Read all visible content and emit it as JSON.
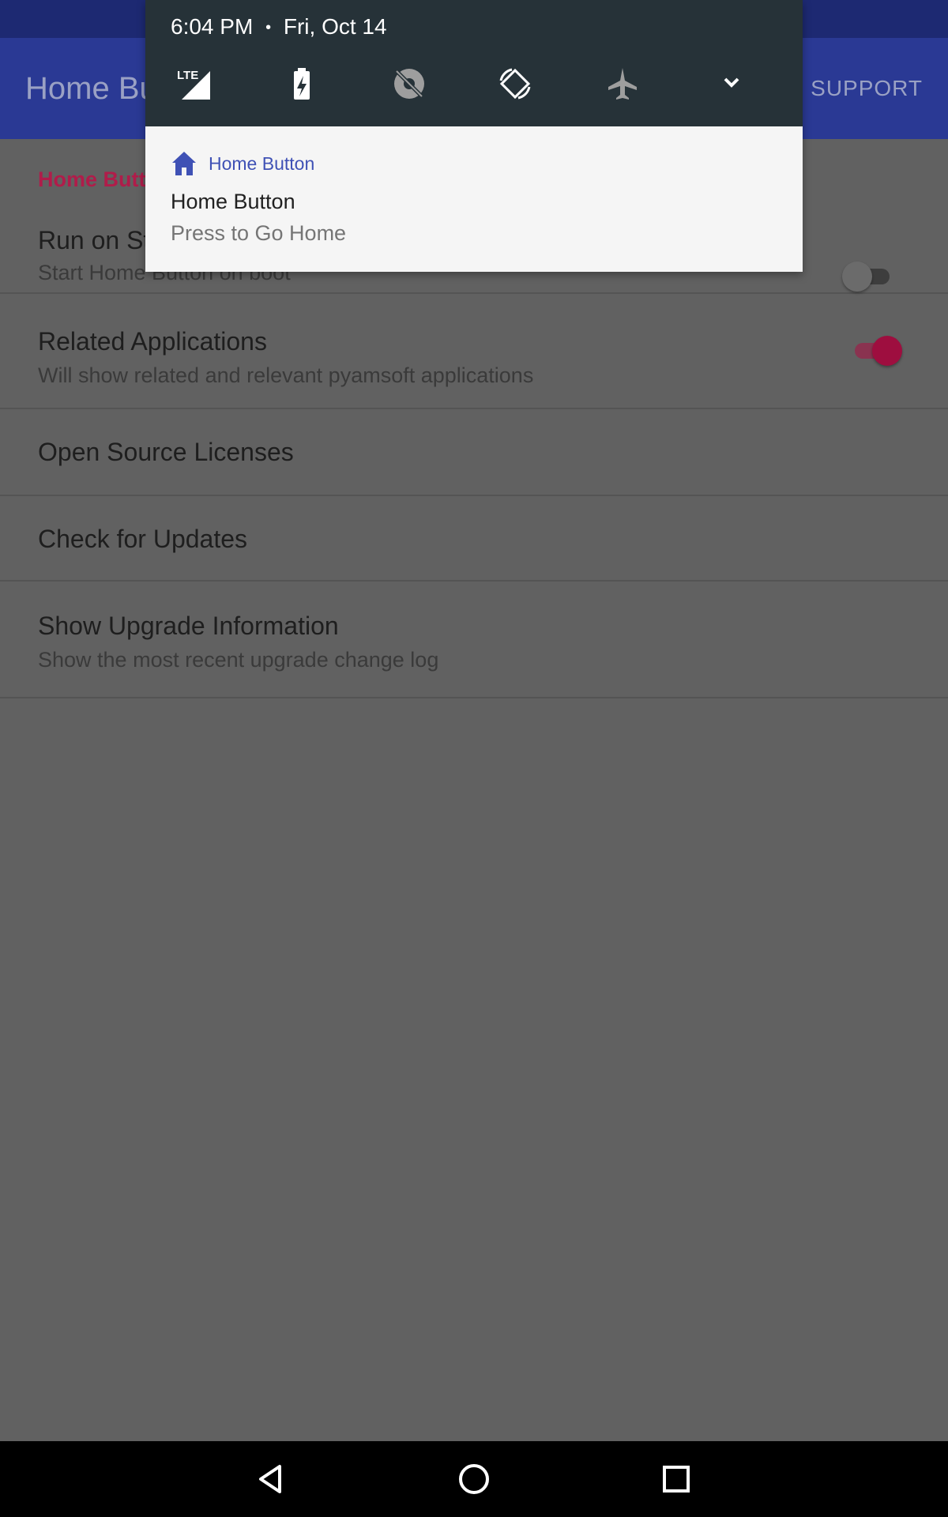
{
  "app": {
    "title": "Home Button",
    "support_label": "SUPPORT",
    "section_header": "Home Button"
  },
  "preferences": [
    {
      "title": "Run on Startup",
      "summary": "Start Home Button on boot",
      "switch": "off"
    },
    {
      "title": "Related Applications",
      "summary": "Will show related and relevant pyamsoft applications",
      "switch": "on"
    },
    {
      "title": "Open Source Licenses",
      "summary": ""
    },
    {
      "title": "Check for Updates",
      "summary": ""
    },
    {
      "title": "Show Upgrade Information",
      "summary": "Show the most recent upgrade change log"
    }
  ],
  "shade": {
    "time": "6:04 PM",
    "separator": "•",
    "date": "Fri, Oct 14",
    "quick_settings": [
      "lte-signal-icon",
      "battery-saver-icon",
      "location-off-icon",
      "auto-rotate-icon",
      "airplane-mode-icon",
      "expand-chevron-icon"
    ],
    "signal_label": "LTE"
  },
  "notification": {
    "app_icon": "home-icon",
    "app_name": "Home Button",
    "title": "Home Button",
    "text": "Press to Go Home"
  },
  "nav": {
    "buttons": [
      "back-icon",
      "home-icon",
      "recents-icon"
    ]
  },
  "colors": {
    "primary": "#2a3994",
    "status_bar": "#1d2972",
    "accent": "#9e0e3f",
    "shade_header": "#263238",
    "notification_bg": "#f5f5f5",
    "notification_app": "#3f51b5"
  }
}
